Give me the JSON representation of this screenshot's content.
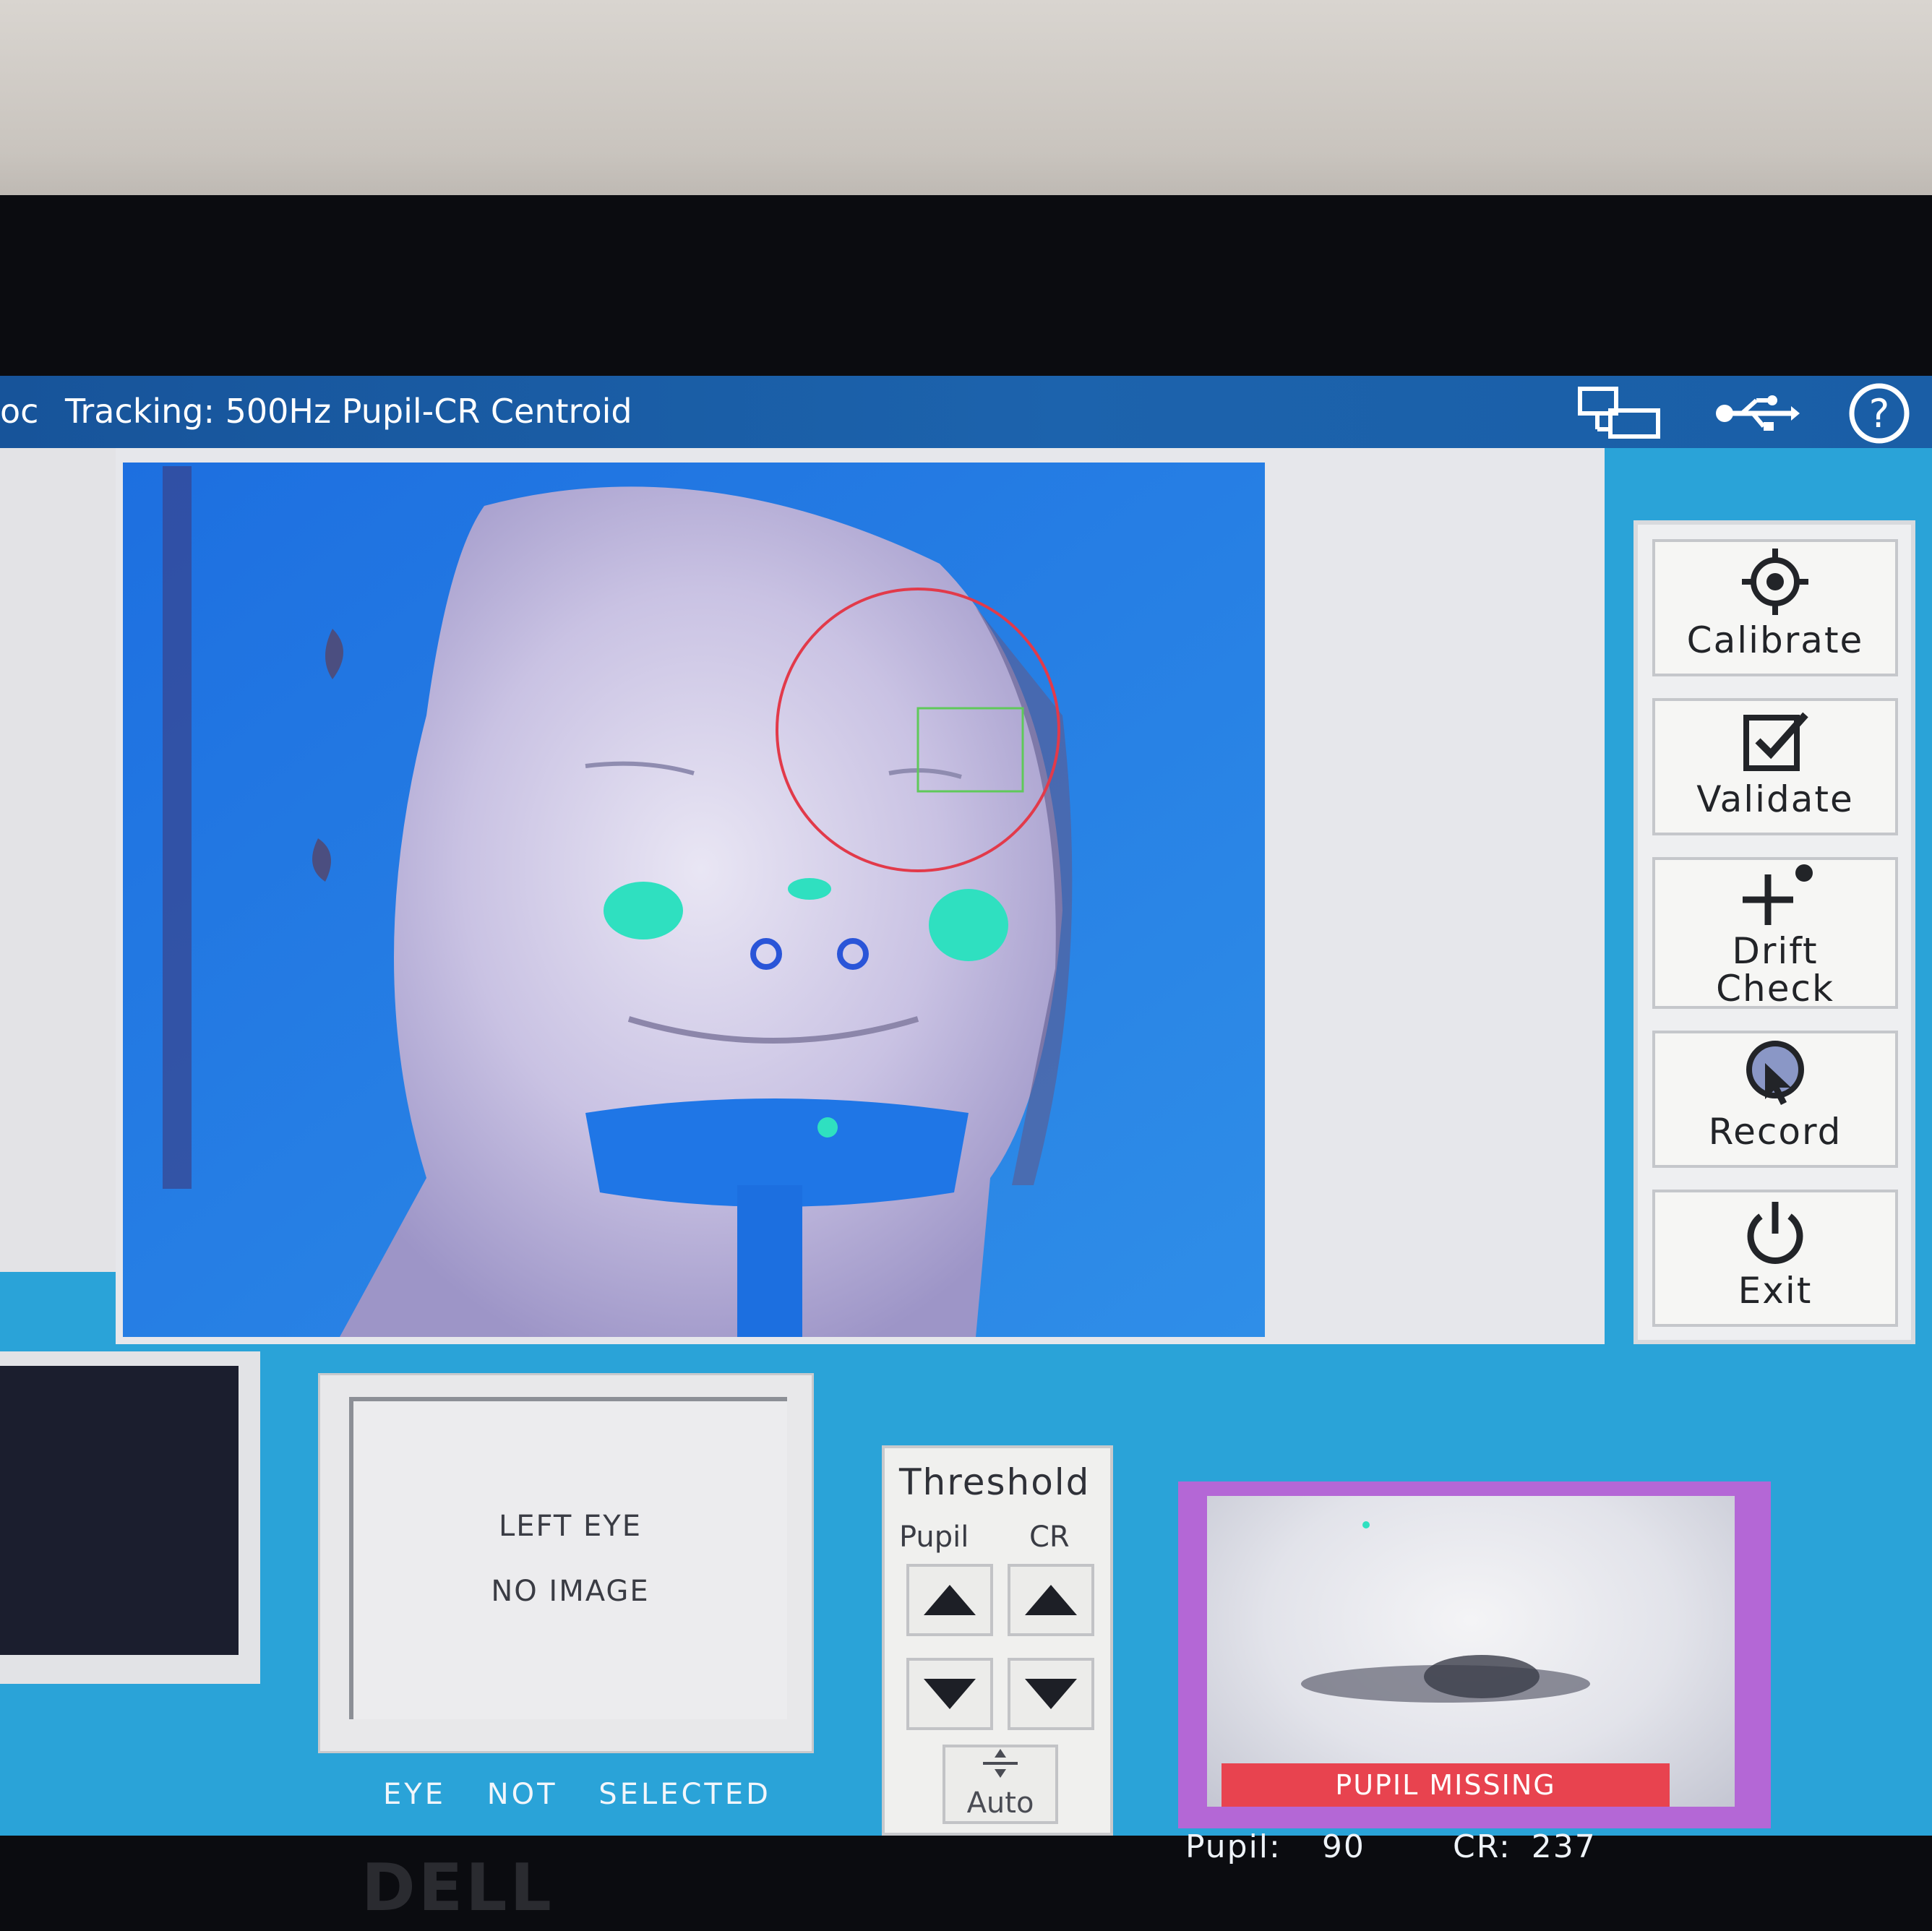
{
  "topbar": {
    "title_prefix": "oc",
    "title": "Tracking: 500Hz Pupil-CR Centroid",
    "icons": [
      "network-icon",
      "usb-icon",
      "help-icon"
    ]
  },
  "sidebar": {
    "buttons": [
      {
        "label": "Calibrate",
        "icon": "crosshair-icon"
      },
      {
        "label": "Validate",
        "icon": "checkbox-icon"
      },
      {
        "label": "Drift\nCheck",
        "icon": "plus-dot-icon"
      },
      {
        "label": "Record",
        "icon": "record-icon"
      },
      {
        "label": "Exit",
        "icon": "power-icon"
      }
    ]
  },
  "left_eye": {
    "line1": "LEFT EYE",
    "line2": "NO IMAGE",
    "caption": "EYE NOT SELECTED"
  },
  "threshold": {
    "title": "Threshold",
    "pupil_label": "Pupil",
    "cr_label": "CR",
    "auto_label": "Auto"
  },
  "eye_view": {
    "status": "PUPIL MISSING",
    "pupil_label": "Pupil:",
    "pupil_value": "90",
    "cr_label": "CR:",
    "cr_value": "237",
    "status_color": "#e8434f",
    "frame_color": "#b467d6"
  },
  "colors": {
    "accent_blue": "#1c63ad",
    "screen_bg": "#2aa3d8",
    "tracking_circle": "#e23a4a",
    "eye_box": "#5fc95a"
  }
}
